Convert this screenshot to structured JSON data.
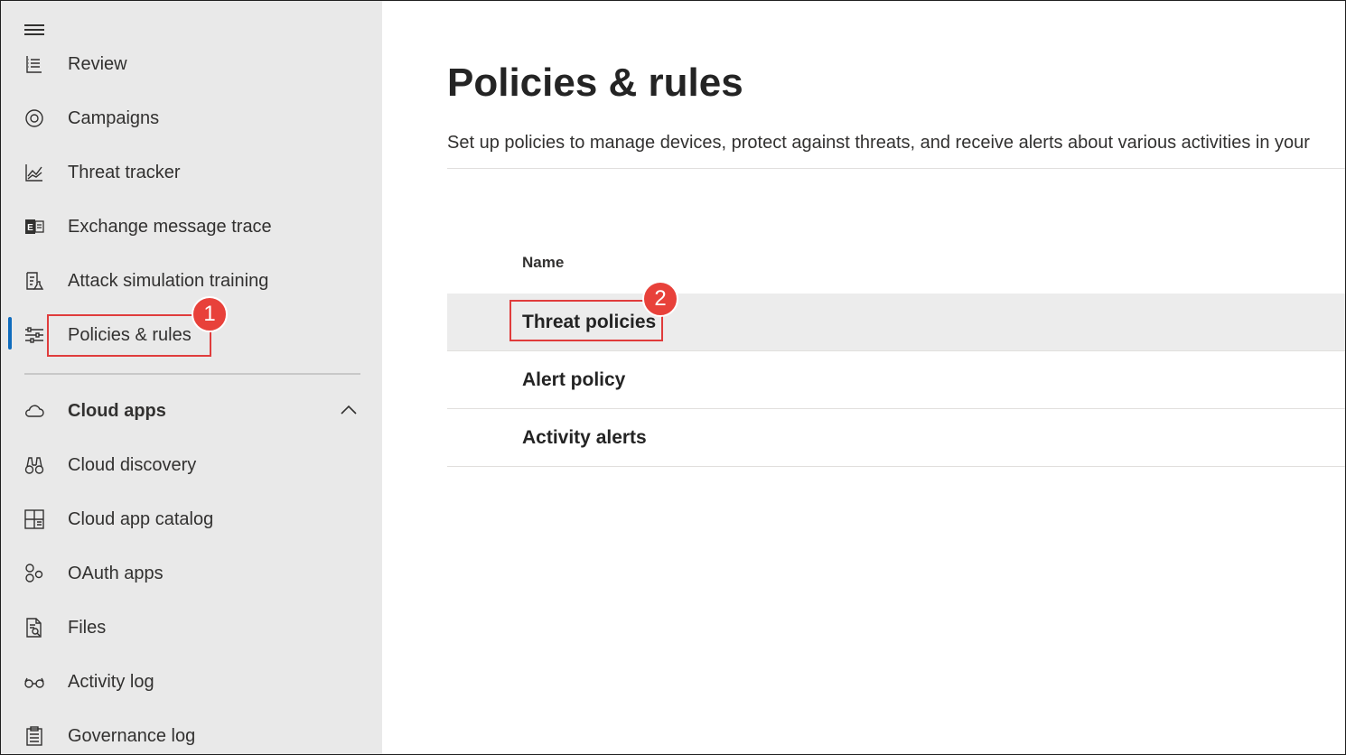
{
  "sidebar": {
    "items": [
      {
        "label": "Review",
        "icon": "review-icon"
      },
      {
        "label": "Campaigns",
        "icon": "campaigns-icon"
      },
      {
        "label": "Threat tracker",
        "icon": "threat-tracker-icon"
      },
      {
        "label": "Exchange message trace",
        "icon": "exchange-icon"
      },
      {
        "label": "Attack simulation training",
        "icon": "attack-simulation-icon"
      },
      {
        "label": "Policies & rules",
        "icon": "policies-rules-icon",
        "active": true
      }
    ],
    "section": {
      "label": "Cloud apps",
      "icon": "cloud-icon",
      "expanded": true
    },
    "cloud_items": [
      {
        "label": "Cloud discovery",
        "icon": "binoculars-icon"
      },
      {
        "label": "Cloud app catalog",
        "icon": "app-catalog-icon"
      },
      {
        "label": "OAuth apps",
        "icon": "oauth-apps-icon"
      },
      {
        "label": "Files",
        "icon": "files-icon"
      },
      {
        "label": "Activity log",
        "icon": "glasses-icon"
      },
      {
        "label": "Governance log",
        "icon": "clipboard-icon"
      }
    ]
  },
  "main": {
    "title": "Policies & rules",
    "description": "Set up policies to manage devices, protect against threats, and receive alerts about various activities in your",
    "column_header": "Name",
    "rows": [
      {
        "label": "Threat policies",
        "selected": true
      },
      {
        "label": "Alert policy"
      },
      {
        "label": "Activity alerts"
      }
    ]
  },
  "annotations": {
    "step1": "1",
    "step2": "2"
  },
  "colors": {
    "sidebar_bg": "#e9e9e9",
    "accent": "#0f6cbd",
    "annotation": "#e8413a",
    "selected_row": "#ececec"
  }
}
